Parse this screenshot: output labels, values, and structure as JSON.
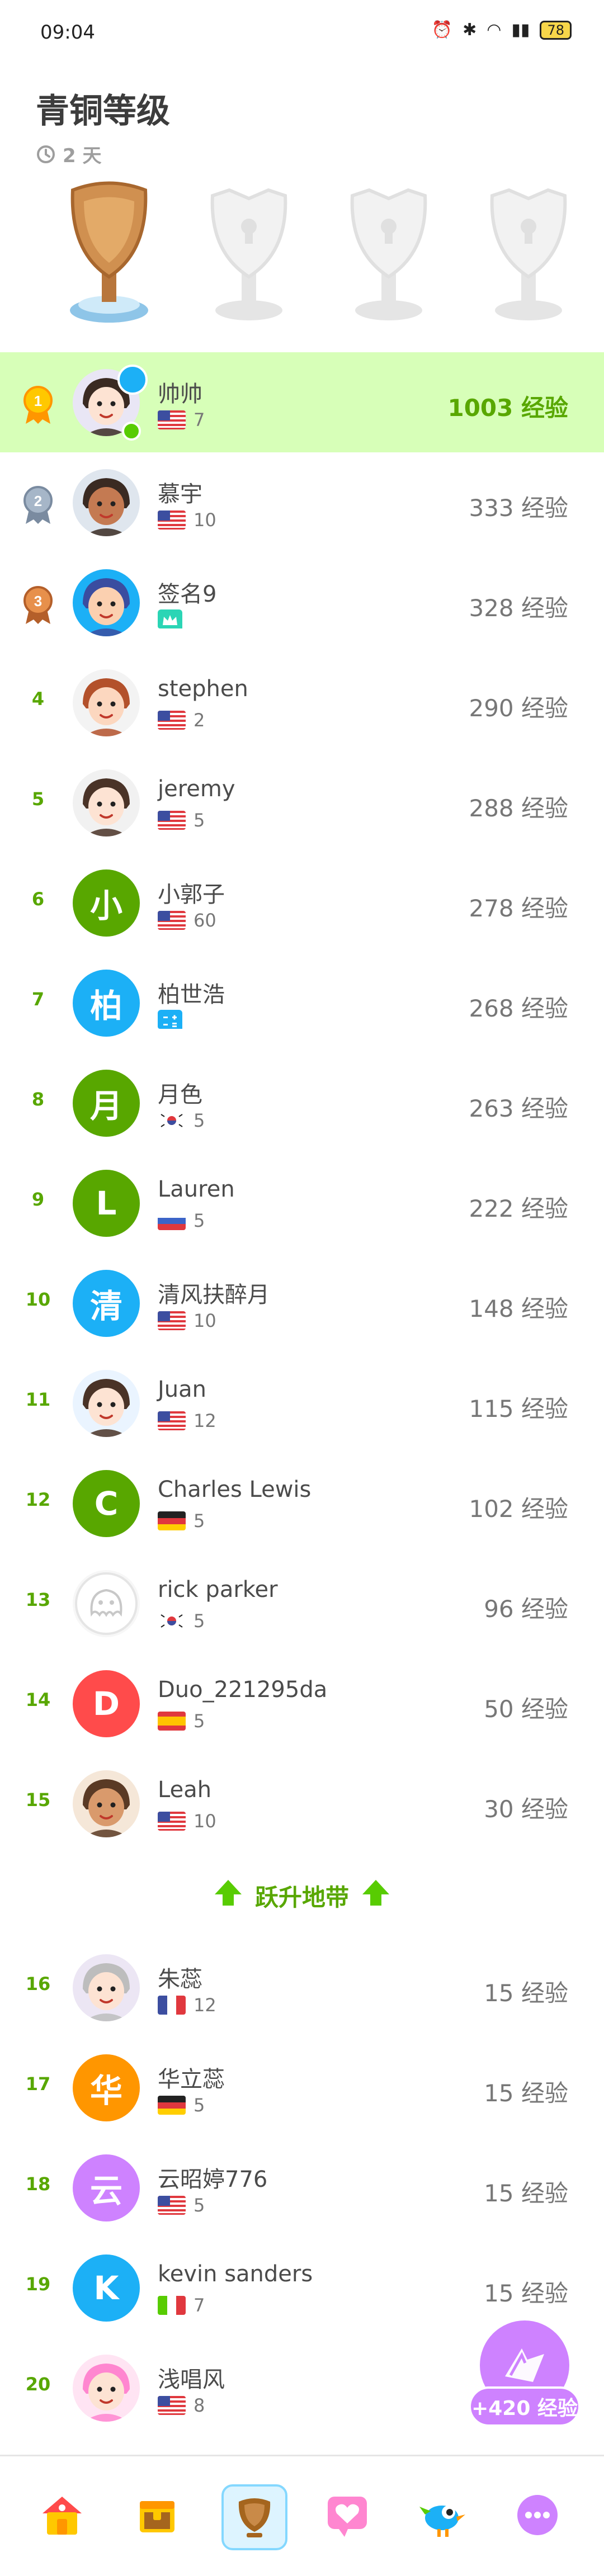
{
  "status_bar": {
    "time": "09:04",
    "battery": "78"
  },
  "header": {
    "title": "青铜等级",
    "days": "2 天"
  },
  "rows": [
    {
      "rank": "1",
      "name": "帅帅",
      "count": "7",
      "xp": "1003 经验",
      "flag": "us",
      "avatar": "cartoon-girl",
      "me": true
    },
    {
      "rank": "2",
      "name": "慕宇",
      "count": "10",
      "xp": "333 经验",
      "flag": "us",
      "avatar": "cartoon-man"
    },
    {
      "rank": "3",
      "name": "签名9",
      "count": "",
      "xp": "328 经验",
      "flag": "crown",
      "avatar": "cartoon-boy"
    },
    {
      "rank": "4",
      "name": "stephen",
      "count": "2",
      "xp": "290 经验",
      "flag": "us",
      "avatar": "cartoon-woman"
    },
    {
      "rank": "5",
      "name": "jeremy",
      "count": "5",
      "xp": "288 经验",
      "flag": "us",
      "avatar": "cartoon-glasses"
    },
    {
      "rank": "6",
      "name": "小郭子",
      "count": "60",
      "xp": "278 经验",
      "flag": "us",
      "avatar": "小",
      "color": "#58a700"
    },
    {
      "rank": "7",
      "name": "柏世浩",
      "count": "",
      "xp": "268 经验",
      "flag": "calc",
      "avatar": "柏",
      "color": "#1cb0f6"
    },
    {
      "rank": "8",
      "name": "月色",
      "count": "5",
      "xp": "263 经验",
      "flag": "kr",
      "avatar": "月",
      "color": "#58a700"
    },
    {
      "rank": "9",
      "name": "Lauren",
      "count": "5",
      "xp": "222 经验",
      "flag": "ru",
      "avatar": "L",
      "color": "#58a700"
    },
    {
      "rank": "10",
      "name": "清风扶醉月",
      "count": "10",
      "xp": "148 经验",
      "flag": "us",
      "avatar": "清",
      "color": "#1cb0f6"
    },
    {
      "rank": "11",
      "name": "Juan",
      "count": "12",
      "xp": "115 经验",
      "flag": "us",
      "avatar": "cartoon-juan"
    },
    {
      "rank": "12",
      "name": "Charles Lewis",
      "count": "5",
      "xp": "102 经验",
      "flag": "de",
      "avatar": "C",
      "color": "#58a700"
    },
    {
      "rank": "13",
      "name": "rick parker",
      "count": "5",
      "xp": "96 经验",
      "flag": "kr",
      "avatar": "ghost"
    },
    {
      "rank": "14",
      "name": "Duo_221295da",
      "count": "5",
      "xp": "50 经验",
      "flag": "es",
      "avatar": "D",
      "color": "#ff4b4b"
    },
    {
      "rank": "15",
      "name": "Leah",
      "count": "10",
      "xp": "30 经验",
      "flag": "us",
      "avatar": "cartoon-leah"
    }
  ],
  "promotion_zone": {
    "label": "跃升地带"
  },
  "rows_below": [
    {
      "rank": "16",
      "name": "朱蕊",
      "count": "12",
      "xp": "15 经验",
      "flag": "fr",
      "avatar": "cartoon-grandma"
    },
    {
      "rank": "17",
      "name": "华立蕊",
      "count": "5",
      "xp": "15 经验",
      "flag": "de",
      "avatar": "华",
      "color": "#ff9600"
    },
    {
      "rank": "18",
      "name": "云昭婷776",
      "count": "5",
      "xp": "15 经验",
      "flag": "us",
      "avatar": "云",
      "color": "#ce82ff"
    },
    {
      "rank": "19",
      "name": "kevin sanders",
      "count": "7",
      "xp": "15 经验",
      "flag": "it",
      "avatar": "K",
      "color": "#1cb0f6"
    },
    {
      "rank": "20",
      "name": "浅唱风",
      "count": "8",
      "xp": "",
      "flag": "us",
      "avatar": "cartoon-pink"
    }
  ],
  "xp_boost": {
    "label": "+420 经验"
  },
  "nav": [
    {
      "name": "home",
      "icon": "home-icon"
    },
    {
      "name": "chest",
      "icon": "chest-icon"
    },
    {
      "name": "leaderboard",
      "icon": "trophy-icon"
    },
    {
      "name": "health",
      "icon": "heart-icon"
    },
    {
      "name": "bird",
      "icon": "bird-icon"
    },
    {
      "name": "more",
      "icon": "more-icon"
    }
  ]
}
